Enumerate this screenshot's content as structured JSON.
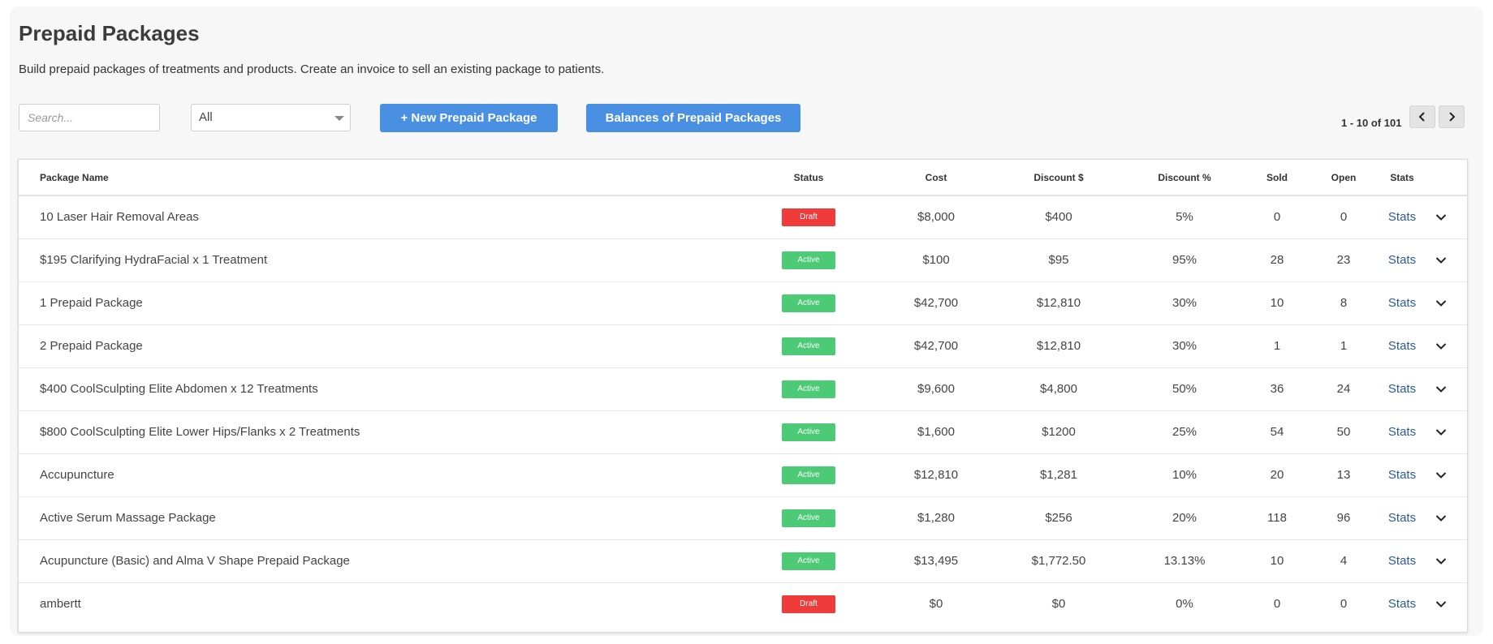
{
  "page": {
    "title": "Prepaid Packages",
    "subtitle": "Build prepaid packages of treatments and products. Create an invoice to sell an existing package to patients."
  },
  "toolbar": {
    "search_placeholder": "Search...",
    "filter_value": "All",
    "new_button_label": "+ New Prepaid Package",
    "balances_button_label": "Balances of Prepaid Packages"
  },
  "pagination": {
    "text": "1 - 10 of 101",
    "prev_icon": "chevron-left-icon",
    "next_icon": "chevron-right-icon"
  },
  "table": {
    "headers": {
      "name": "Package Name",
      "status": "Status",
      "cost": "Cost",
      "discount_amount": "Discount $",
      "discount_percent": "Discount %",
      "sold": "Sold",
      "open": "Open",
      "stats": "Stats"
    },
    "rows": [
      {
        "name": "10 Laser Hair Removal Areas",
        "status": "Draft",
        "cost": "$8,000",
        "discount_amount": "$400",
        "discount_percent": "5%",
        "sold": "0",
        "open": "0",
        "stats": "Stats"
      },
      {
        "name": "$195 Clarifying HydraFacial x 1 Treatment",
        "status": "Active",
        "cost": "$100",
        "discount_amount": "$95",
        "discount_percent": "95%",
        "sold": "28",
        "open": "23",
        "stats": "Stats"
      },
      {
        "name": "1 Prepaid Package",
        "status": "Active",
        "cost": "$42,700",
        "discount_amount": "$12,810",
        "discount_percent": "30%",
        "sold": "10",
        "open": "8",
        "stats": "Stats"
      },
      {
        "name": "2 Prepaid Package",
        "status": "Active",
        "cost": "$42,700",
        "discount_amount": "$12,810",
        "discount_percent": "30%",
        "sold": "1",
        "open": "1",
        "stats": "Stats"
      },
      {
        "name": "$400 CoolSculpting Elite Abdomen x 12 Treatments",
        "status": "Active",
        "cost": "$9,600",
        "discount_amount": "$4,800",
        "discount_percent": "50%",
        "sold": "36",
        "open": "24",
        "stats": "Stats"
      },
      {
        "name": "$800 CoolSculpting Elite Lower Hips/Flanks x 2 Treatments",
        "status": "Active",
        "cost": "$1,600",
        "discount_amount": "$1200",
        "discount_percent": "25%",
        "sold": "54",
        "open": "50",
        "stats": "Stats"
      },
      {
        "name": "Accupuncture",
        "status": "Active",
        "cost": "$12,810",
        "discount_amount": "$1,281",
        "discount_percent": "10%",
        "sold": "20",
        "open": "13",
        "stats": "Stats"
      },
      {
        "name": "Active Serum Massage Package",
        "status": "Active",
        "cost": "$1,280",
        "discount_amount": "$256",
        "discount_percent": "20%",
        "sold": "118",
        "open": "96",
        "stats": "Stats"
      },
      {
        "name": "Acupuncture (Basic) and Alma V Shape Prepaid Package",
        "status": "Active",
        "cost": "$13,495",
        "discount_amount": "$1,772.50",
        "discount_percent": "13.13%",
        "sold": "10",
        "open": "4",
        "stats": "Stats"
      },
      {
        "name": "ambertt",
        "status": "Draft",
        "cost": "$0",
        "discount_amount": "$0",
        "discount_percent": "0%",
        "sold": "0",
        "open": "0",
        "stats": "Stats"
      }
    ],
    "row_expand_icon": "chevron-down-icon"
  },
  "colors": {
    "primary_button": "#4a90e2",
    "status_active": "#4cca76",
    "status_draft": "#f03b3b",
    "link": "#2a5a9c",
    "panel_background": "#f7f7f7"
  }
}
